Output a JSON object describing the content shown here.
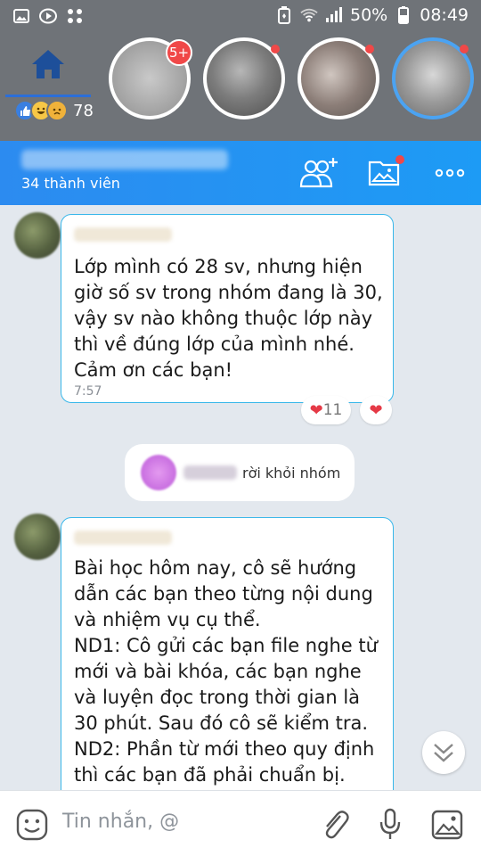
{
  "status_bar": {
    "battery": "50%",
    "time": "08:49"
  },
  "overlay": {
    "reaction_count": "78",
    "unread_badge": "5+"
  },
  "header": {
    "member_count": "34 thành viên"
  },
  "messages": [
    {
      "text": "Lớp mình có 28 sv, nhưng hiện\ngiờ số sv trong nhóm đang là 30,\nvậy sv nào không thuộc lớp này\nthì về đúng lớp của mình nhé.\nCảm ơn các bạn!",
      "time": "7:57",
      "reaction_count": "11"
    },
    {
      "text": "Bài học hôm nay, cô sẽ hướng\ndẫn các bạn theo từng nội dung\nvà nhiệm vụ cụ thể.\nND1: Cô gửi các bạn file nghe từ\nmới và bài khóa, các bạn nghe\nvà luyện đọc trong thời gian là\n30 phút. Sau đó cô sẽ kiểm tra.\nND2: Phần từ mới theo quy định\nthì các bạn đã phải chuẩn bị.\nTrong quá trình chuẩn bị, từ mới"
    }
  ],
  "system_notice": {
    "text": "rời khỏi nhóm"
  },
  "composer": {
    "placeholder": "Tin nhắn, @"
  },
  "colors": {
    "header_blue": "#1d9bf5",
    "bubble_border": "#38b7ea",
    "heart": "#e53946",
    "badge_red": "#f04848"
  }
}
